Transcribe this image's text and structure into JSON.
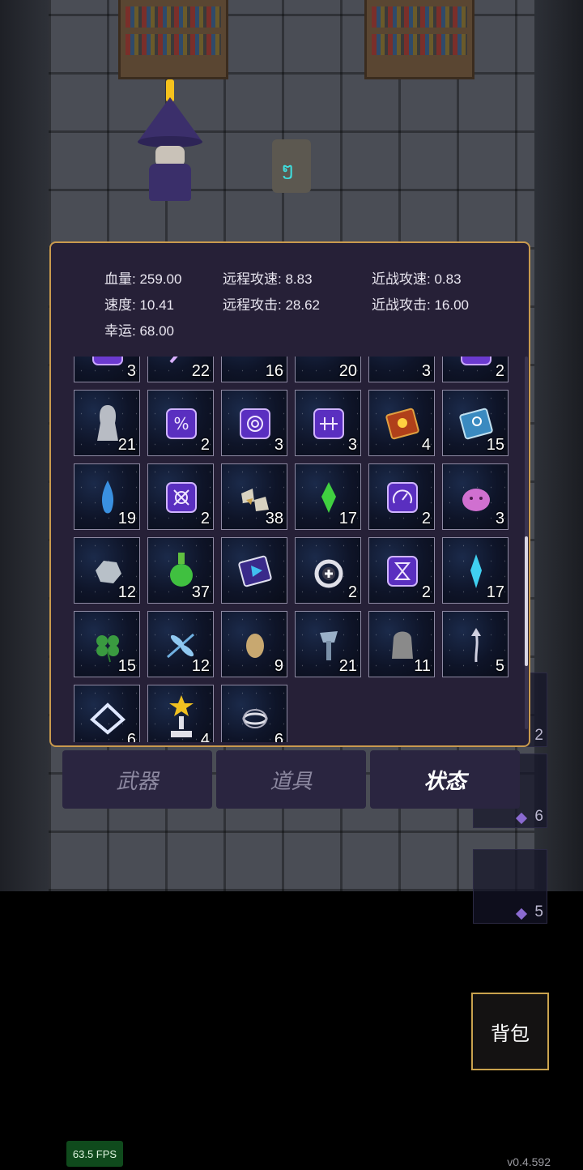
{
  "stats": [
    {
      "label": "血量:",
      "value": "259.00"
    },
    {
      "label": "远程攻速:",
      "value": "8.83"
    },
    {
      "label": "近战攻速:",
      "value": "0.83"
    },
    {
      "label": "速度:",
      "value": "10.41"
    },
    {
      "label": "远程攻击:",
      "value": "28.62"
    },
    {
      "label": "近战攻击:",
      "value": "16.00"
    },
    {
      "label": "幸运:",
      "value": "68.00"
    }
  ],
  "inventory": [
    {
      "icon": "purple-rune-icon",
      "count": "3"
    },
    {
      "icon": "purple-wand-icon",
      "count": "22"
    },
    {
      "icon": "red-gem-icon",
      "count": "16"
    },
    {
      "icon": "gold-scroll-icon",
      "count": "20"
    },
    {
      "icon": "yellow-item-icon",
      "count": "3"
    },
    {
      "icon": "purple-rune-icon",
      "count": "2"
    },
    {
      "icon": "ghost-statue-icon",
      "count": "21"
    },
    {
      "icon": "percent-rune-icon",
      "count": "2"
    },
    {
      "icon": "swirl-rune-icon",
      "count": "3"
    },
    {
      "icon": "cross-rune-icon",
      "count": "3"
    },
    {
      "icon": "red-spellbook-icon",
      "count": "4"
    },
    {
      "icon": "blue-spellbook-icon",
      "count": "15"
    },
    {
      "icon": "blue-droplet-icon",
      "count": "19"
    },
    {
      "icon": "x-rune-icon",
      "count": "2"
    },
    {
      "icon": "ore-chunks-icon",
      "count": "38"
    },
    {
      "icon": "green-crystal-icon",
      "count": "17"
    },
    {
      "icon": "gauge-rune-icon",
      "count": "2"
    },
    {
      "icon": "pink-slime-icon",
      "count": "3"
    },
    {
      "icon": "grey-stone-icon",
      "count": "12"
    },
    {
      "icon": "green-potion-icon",
      "count": "37"
    },
    {
      "icon": "arcane-tome-icon",
      "count": ""
    },
    {
      "icon": "silver-ring-icon",
      "count": "2"
    },
    {
      "icon": "hourglass-rune-icon",
      "count": "2"
    },
    {
      "icon": "cyan-crystal-icon",
      "count": "17"
    },
    {
      "icon": "four-leaf-clover-icon",
      "count": "15"
    },
    {
      "icon": "dragonfly-icon",
      "count": "12"
    },
    {
      "icon": "egg-icon",
      "count": "9"
    },
    {
      "icon": "axe-totem-icon",
      "count": "21"
    },
    {
      "icon": "tombstone-icon",
      "count": "11"
    },
    {
      "icon": "hook-arrow-icon",
      "count": "5"
    },
    {
      "icon": "diamond-tile-icon",
      "count": "6"
    },
    {
      "icon": "star-trophy-icon",
      "count": "4"
    },
    {
      "icon": "orbit-ring-icon",
      "count": "6"
    }
  ],
  "tabs": [
    {
      "label": "武器",
      "active": false
    },
    {
      "label": "道具",
      "active": false
    },
    {
      "label": "状态",
      "active": true
    }
  ],
  "side_slots": [
    {
      "count": "2"
    },
    {
      "count": "6"
    },
    {
      "count": "5"
    }
  ],
  "bag_button": "背包",
  "fps": "63.5 FPS",
  "version": "v0.4.592",
  "colors": {
    "panel_border": "#c99a4e",
    "panel_bg": "#262037",
    "fps_bg": "#0f4a1c"
  }
}
